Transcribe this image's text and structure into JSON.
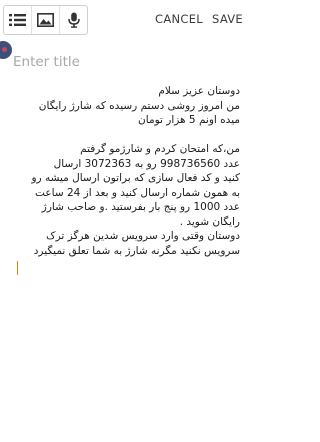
{
  "toolbar": {
    "icons": [
      "list-icon",
      "image-icon",
      "microphone-icon"
    ],
    "cancel_label": "CANCEL",
    "save_label": "SAVE"
  },
  "title_field": {
    "placeholder": "Enter title",
    "value": ""
  },
  "note_body": {
    "lines": [
      "دوستان عزیز سلام",
      "من امروز روشی دستم رسیده که شارژ رایگان",
      "میده اونم 5 هزار تومان",
      "",
      "من،که امتحان کردم و شارژمو گرفتم",
      "عدد 998736560 رو به 3072363 ارسال",
      "کنید و کد فعال سازی که براتون ارسال میشه رو",
      "به همون شماره ارسال کنید و بعد از 24 ساعت",
      "عدد 1000 رو پنج بار بفرستید .و صاحب شارژ",
      "رایگان شوید .",
      "دوستان وقتی وارد سرویس شدین هرگز ترک",
      "سرویس نکنید مگرنه شارژ به شما تعلق نمیگیرد"
    ]
  }
}
